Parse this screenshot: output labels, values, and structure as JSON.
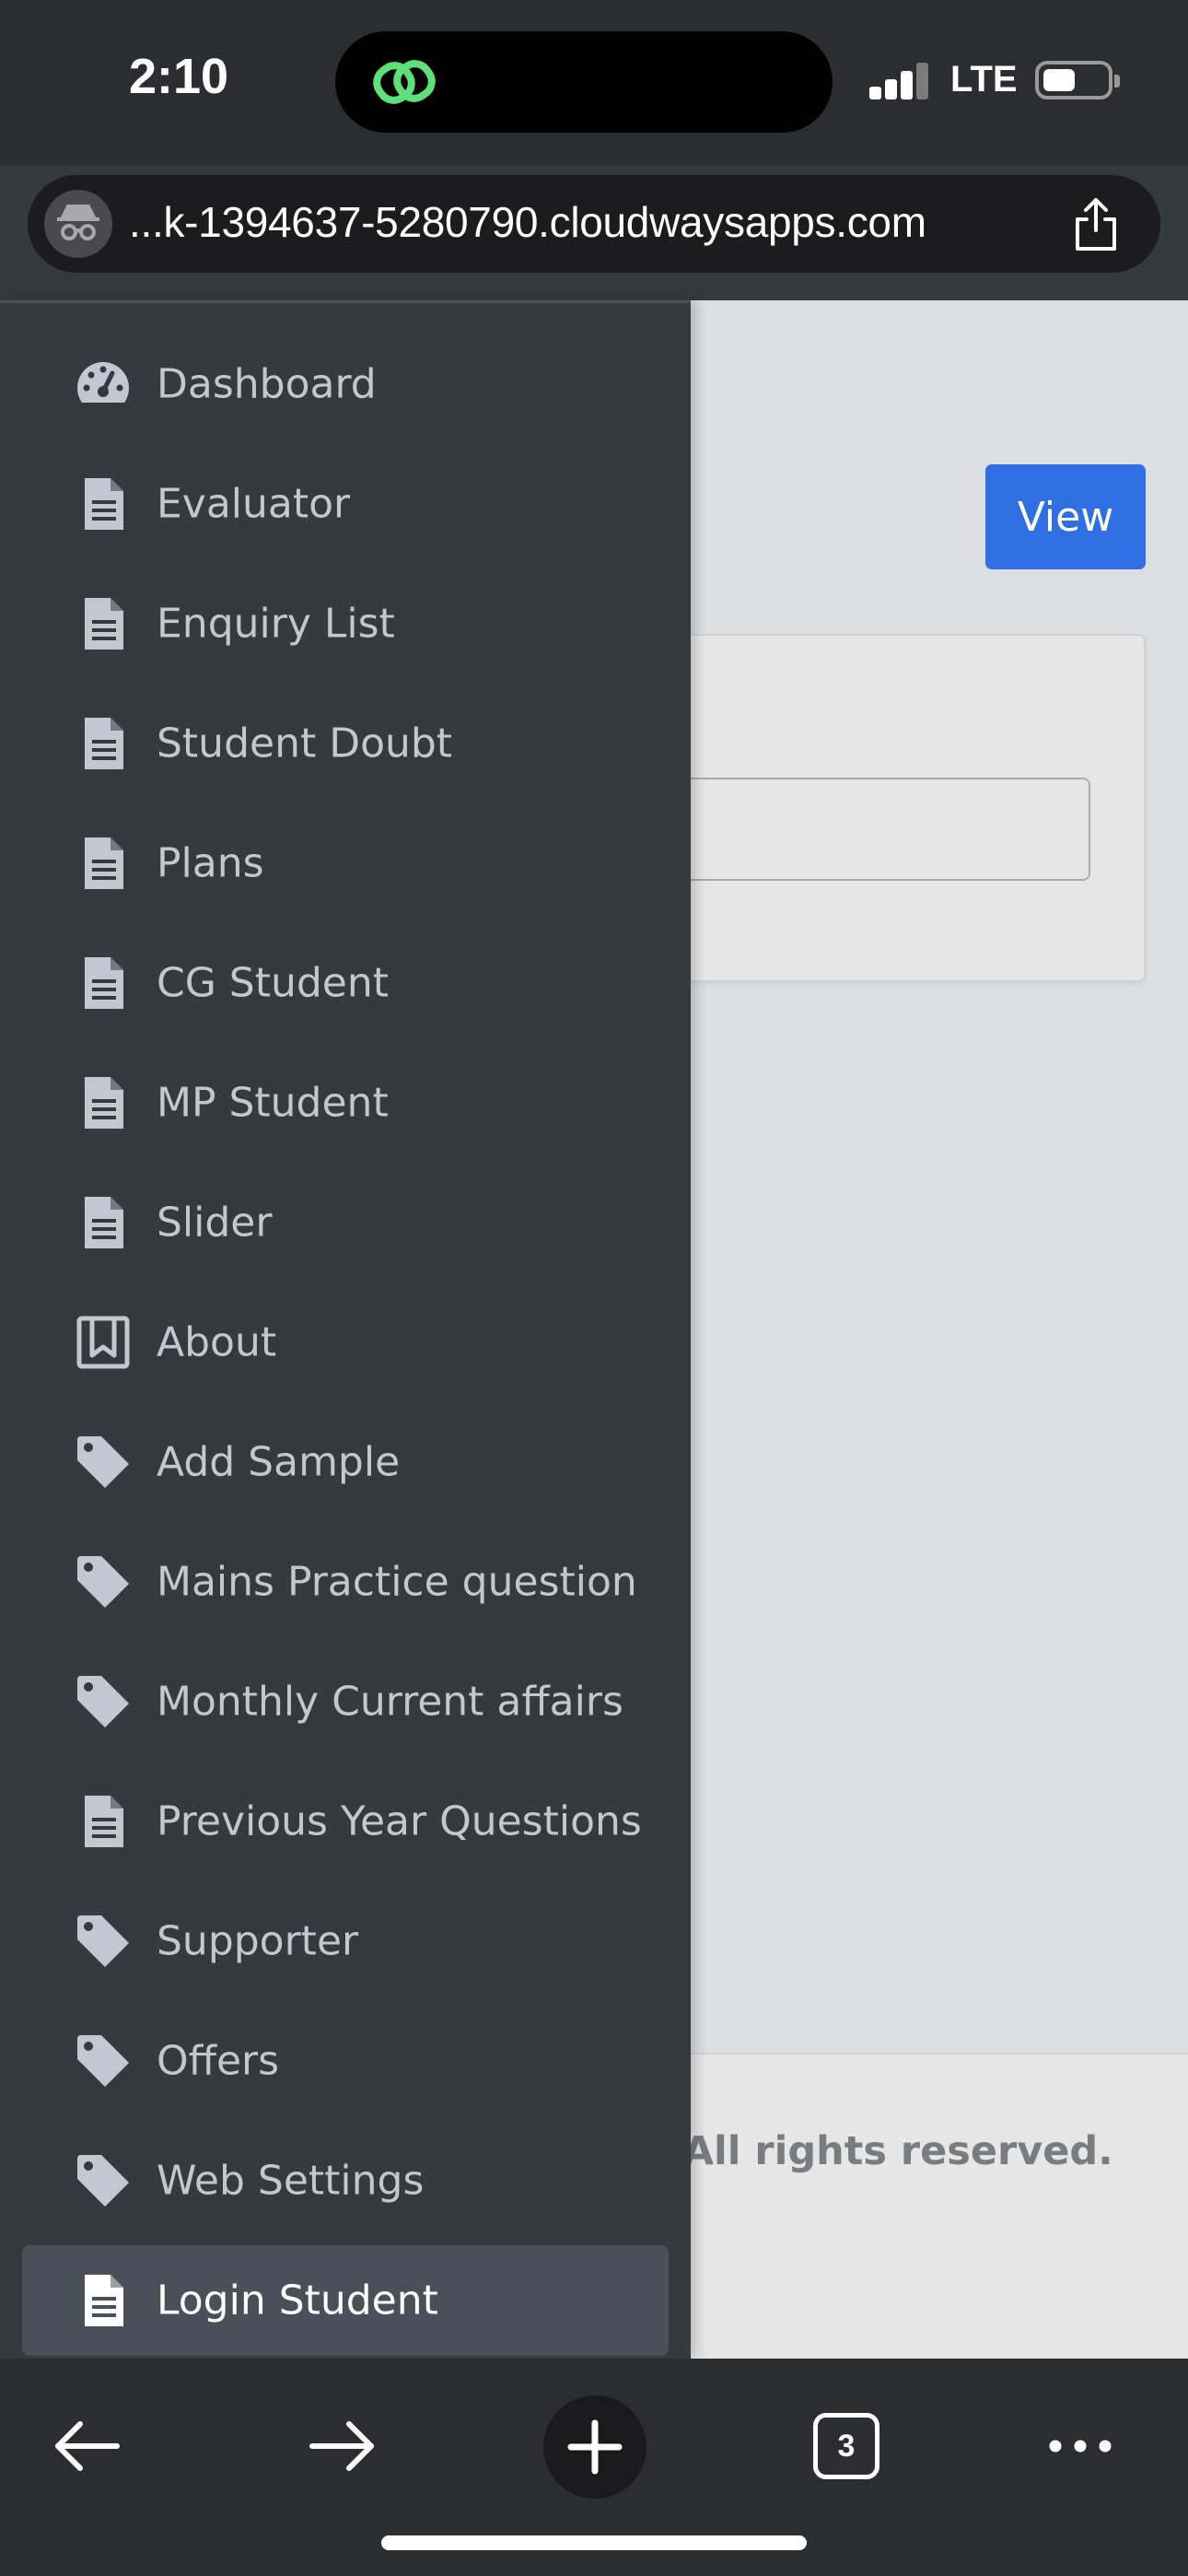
{
  "status_bar": {
    "time": "2:10",
    "network": "LTE"
  },
  "browser": {
    "url": "...k-1394637-5280790.cloudwaysapps.com",
    "open_tabs_count": "3"
  },
  "main": {
    "view_button_label": "View",
    "footer_text": "rld All rights reserved."
  },
  "sidebar": {
    "items": [
      {
        "label": "Dashboard",
        "icon": "tachometer-icon"
      },
      {
        "label": "Evaluator",
        "icon": "file-icon"
      },
      {
        "label": "Enquiry List",
        "icon": "file-icon"
      },
      {
        "label": "Student Doubt",
        "icon": "file-icon"
      },
      {
        "label": "Plans",
        "icon": "file-icon"
      },
      {
        "label": "CG Student",
        "icon": "file-icon"
      },
      {
        "label": "MP Student",
        "icon": "file-icon"
      },
      {
        "label": "Slider",
        "icon": "file-icon"
      },
      {
        "label": "About",
        "icon": "bookmark-icon"
      },
      {
        "label": "Add Sample",
        "icon": "tag-icon"
      },
      {
        "label": "Mains Practice question",
        "icon": "tag-icon"
      },
      {
        "label": "Monthly Current affairs",
        "icon": "tag-icon"
      },
      {
        "label": "Previous Year Questions",
        "icon": "file-icon"
      },
      {
        "label": "Supporter",
        "icon": "tag-icon"
      },
      {
        "label": "Offers",
        "icon": "tag-icon"
      },
      {
        "label": "Web Settings",
        "icon": "tag-icon"
      },
      {
        "label": "Login Student",
        "icon": "file-icon",
        "active": true
      }
    ]
  },
  "colors": {
    "sidebar_bg": "#343a40",
    "sidebar_text": "#c2c7d0",
    "active_item_bg": "#495057",
    "primary_button": "#2f6fe3",
    "content_bg": "#dcdee1"
  }
}
